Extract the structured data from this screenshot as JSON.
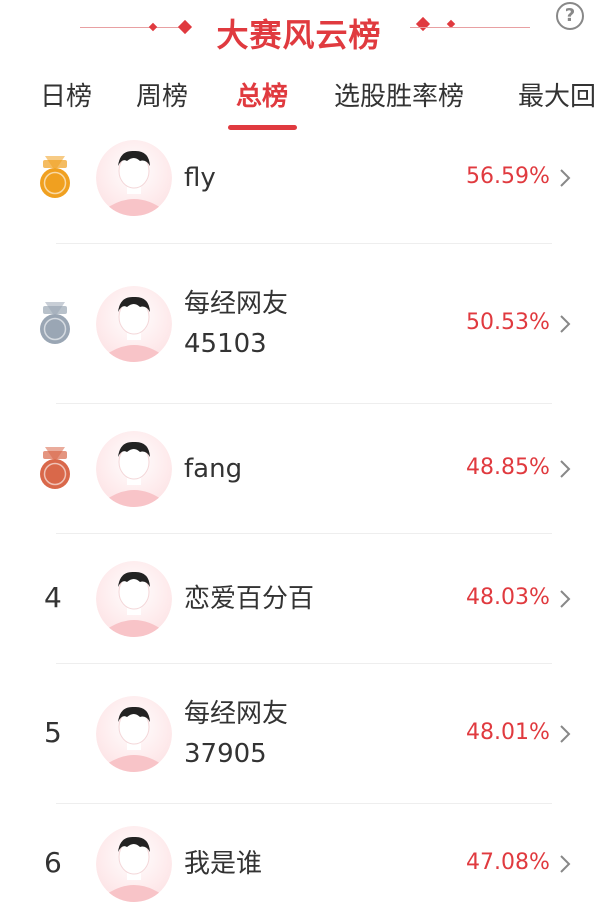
{
  "header": {
    "title": "大赛风云榜",
    "help_symbol": "?"
  },
  "tabs": [
    {
      "label": "日榜",
      "active": false
    },
    {
      "label": "周榜",
      "active": false
    },
    {
      "label": "总榜",
      "active": true
    },
    {
      "label": "选股胜率榜",
      "active": false
    },
    {
      "label": "最大回",
      "active": false
    }
  ],
  "ranking": [
    {
      "rank": "1",
      "name_line1": "fly",
      "name_line2": "",
      "rate": "56.59%",
      "medal": "gold"
    },
    {
      "rank": "2",
      "name_line1": "每经网友",
      "name_line2": "45103",
      "rate": "50.53%",
      "medal": "silver"
    },
    {
      "rank": "3",
      "name_line1": "fang",
      "name_line2": "",
      "rate": "48.85%",
      "medal": "bronze"
    },
    {
      "rank": "4",
      "name_line1": "恋爱百分百",
      "name_line2": "",
      "rate": "48.03%",
      "medal": ""
    },
    {
      "rank": "5",
      "name_line1": "每经网友",
      "name_line2": "37905",
      "rate": "48.01%",
      "medal": ""
    },
    {
      "rank": "6",
      "name_line1": "我是谁",
      "name_line2": "",
      "rate": "47.08%",
      "medal": ""
    }
  ],
  "colors": {
    "accent": "#e03a3f",
    "gold": "#f0a020",
    "silver": "#9aa6b4",
    "bronze": "#d9684a",
    "avatar_bg": "#fde4e6"
  },
  "icons": {
    "help": "question-circle-icon",
    "row_arrow": "chevron-right-icon",
    "medal": "medal-icon",
    "avatar": "default-avatar-icon"
  }
}
